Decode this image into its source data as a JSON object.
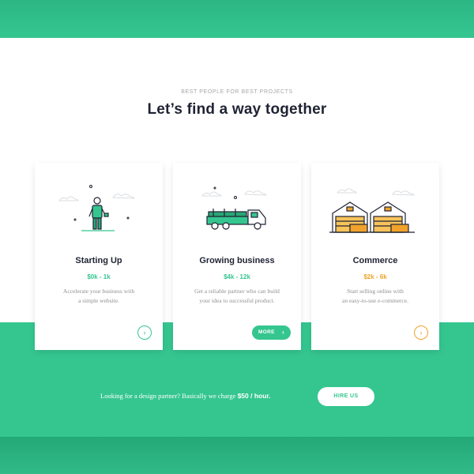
{
  "header": {
    "eyebrow": "BEST PEOPLE FOR BEST PROJECTS",
    "title": "Let’s find a way together"
  },
  "colors": {
    "brand_green": "#35c690",
    "dark_text": "#1f2333",
    "accent_orange": "#f0a22a"
  },
  "cards": [
    {
      "title": "Starting Up",
      "price": "$0k - 1k",
      "desc_line1": "Accelerate your business with",
      "desc_line2": "a simple website.",
      "action": "chevron-circle",
      "arrow": "›",
      "icon": "person-icon"
    },
    {
      "title": "Growing business",
      "price": "$4k - 12k",
      "desc_line1": "Get a reliable partner who can build",
      "desc_line2": "your idea to successful product.",
      "action_label": "MORE",
      "arrow": "›",
      "icon": "truck-icon"
    },
    {
      "title": "Commerce",
      "price": "$2k - 6k",
      "desc_line1": "Start selling online with",
      "desc_line2": "an easy-to-use e-commerce.",
      "action": "chevron-circle",
      "arrow": "›",
      "icon": "warehouse-icon"
    }
  ],
  "cta": {
    "text_before": "Looking for a design partner? Basically we charge ",
    "rate": "$50 / hour.",
    "button_label": "HIRE US"
  }
}
